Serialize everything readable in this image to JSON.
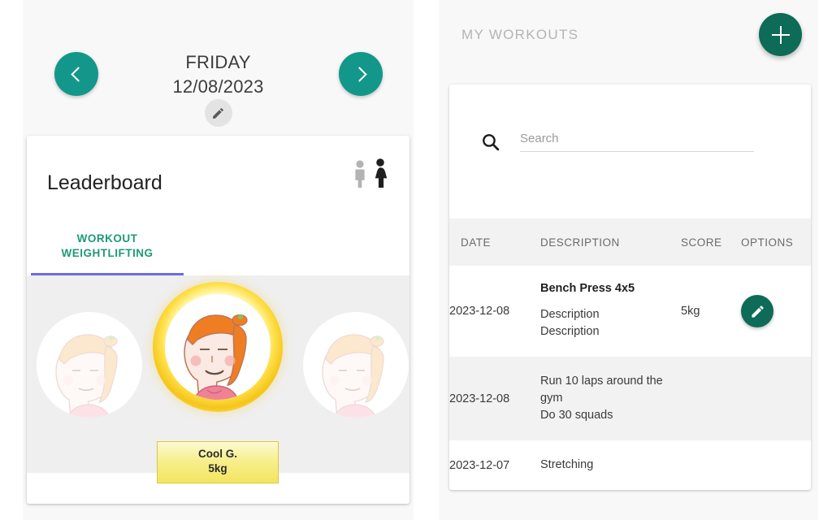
{
  "left_panel": {
    "nav": {
      "prev_icon": "chevron-left-icon",
      "next_icon": "chevron-right-icon",
      "edit_icon": "pencil-icon"
    },
    "weekday": "FRIDAY",
    "date": "12/08/2023",
    "leaderboard": {
      "title": "Leaderboard",
      "gender_icon_male": "male-figure-icon",
      "gender_icon_female": "female-figure-icon",
      "tab_line1": "WORKOUT",
      "tab_line2": "WEIGHTLIFTING",
      "winner": {
        "name": "Cool G.",
        "score": "5kg"
      },
      "accent_tab_color": "#1e9a74",
      "indicator_color": "#6b6be6",
      "gold_color": "#f3e55f"
    },
    "teal_color": "#13978a"
  },
  "right_panel": {
    "title": "MY WORKOUTS",
    "add_button_icon": "plus-icon",
    "add_button_color": "#0e6b58",
    "search": {
      "icon": "search-icon",
      "value": "",
      "placeholder": "Search"
    },
    "table": {
      "columns": [
        "DATE",
        "DESCRIPTION",
        "SCORE",
        "OPTIONS"
      ],
      "rows": [
        {
          "date": "2023-12-08",
          "title": "Bench Press 4x5",
          "lines": [
            "Description",
            "Description"
          ],
          "score": "5kg",
          "option_icon": "pencil-icon"
        },
        {
          "date": "2023-12-08",
          "title": "",
          "lines": [
            "Run 10 laps around the",
            "gym",
            "Do 30 squads"
          ],
          "score": "",
          "option_icon": ""
        },
        {
          "date": "2023-12-07",
          "title": "",
          "lines": [
            "Stretching"
          ],
          "score": "",
          "option_icon": ""
        }
      ]
    }
  }
}
